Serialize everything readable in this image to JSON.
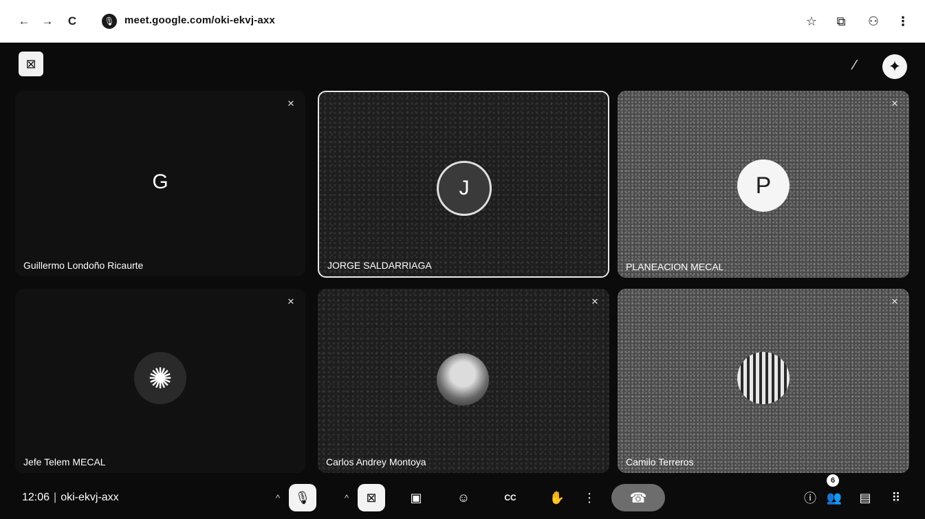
{
  "browser": {
    "back_icon": "←",
    "forward_icon": "→",
    "reload_icon": "C",
    "site_icon": "🎙",
    "url": "meet.google.com/oki-ekvj-axx",
    "bookmark_icon": "☆",
    "extensions_icon": "⧉",
    "profile_icon": "⚇",
    "menu_icon": "⋮"
  },
  "meet": {
    "top_left_icon": "⊠",
    "wand_icon": "⁄",
    "gemini_icon": "✦",
    "mute_icon": "✕",
    "participants": [
      {
        "name": "Guillermo Londoño Ricaurte",
        "avatar": "G"
      },
      {
        "name": "JORGE SALDARRIAGA",
        "avatar": "J"
      },
      {
        "name": "PLANEACION MECAL",
        "avatar": "P"
      },
      {
        "name": "Jefe Telem MECAL",
        "avatar": "✺"
      },
      {
        "name": "Carlos Andrey Montoya",
        "avatar": ""
      },
      {
        "name": "Camilo Terreros",
        "avatar": ""
      }
    ]
  },
  "controls": {
    "time": "12:06",
    "separator": "|",
    "meeting_code": "oki-ekvj-axx",
    "caret": "^",
    "mic_icon": "🎙",
    "camera_icon": "⊠",
    "present_icon": "▣",
    "emoji_icon": "☺",
    "captions_icon": "CC",
    "hand_icon": "✋",
    "more_icon": "⋮",
    "end_call_icon": "☎",
    "info_icon": "ⓘ",
    "people_icon": "👥",
    "people_count": "6",
    "chat_icon": "▤",
    "activities_icon": "⠿"
  }
}
